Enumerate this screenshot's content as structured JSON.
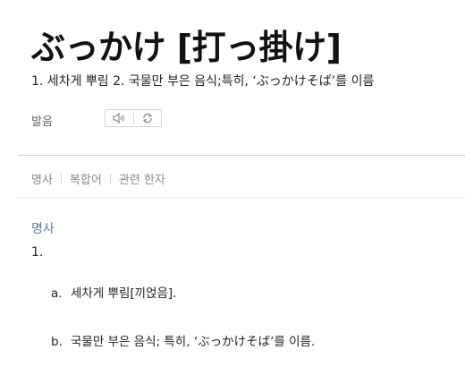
{
  "entry": {
    "headword": "ぶっかけ [打っ掛け]",
    "summary": "1. 세차게 뿌림 2. 국물만 부은 음식;특히, ‘ぶっかけそば’를 이름"
  },
  "pronunciation": {
    "label": "발음",
    "buttons": [
      {
        "icon": "speaker-icon"
      },
      {
        "icon": "repeat-icon"
      }
    ]
  },
  "tabs": [
    "명사",
    "복합어",
    "관련 한자"
  ],
  "definition": {
    "part_of_speech": "명사",
    "sense_number": "1.",
    "subsenses": [
      {
        "marker": "a.",
        "text": "세차게 뿌림[끼얹음]."
      },
      {
        "marker": "b.",
        "text": "국물만 부은 음식; 특히, ‘ぶっかけそば’를 이름."
      }
    ]
  }
}
